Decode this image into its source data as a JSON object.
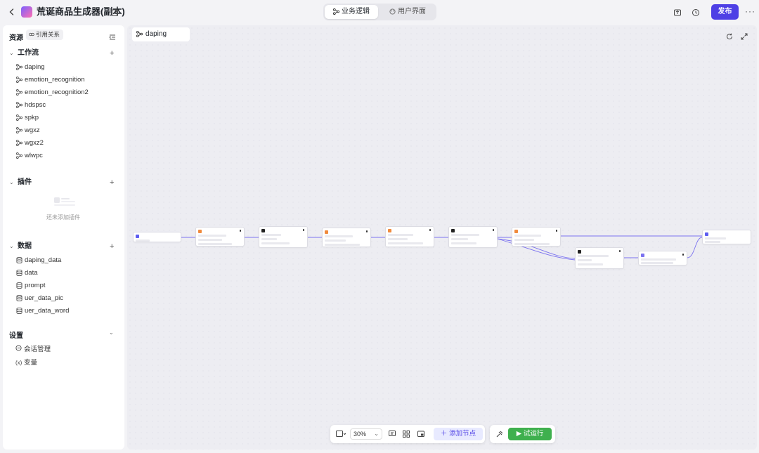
{
  "header": {
    "title": "荒诞商品生成器(副本)",
    "tabs": [
      {
        "label": "业务逻辑",
        "active": true
      },
      {
        "label": "用户界面",
        "active": false
      }
    ],
    "publish_label": "发布"
  },
  "sidebar": {
    "title": "资源",
    "ref_label": "引用关系",
    "workflow_title": "工作流",
    "workflows": [
      "daping",
      "emotion_recognition",
      "emotion_recognition2",
      "hdspsc",
      "spkp",
      "wgxz",
      "wgxz2",
      "wlwpc"
    ],
    "plugin_title": "插件",
    "plugin_empty": "还未添加插件",
    "data_title": "数据",
    "data_items": [
      "daping_data",
      "data",
      "prompt",
      "uer_data_pic",
      "uer_data_word"
    ],
    "settings_title": "设置",
    "settings_items": [
      {
        "icon": "chat-icon",
        "label": "会话管理"
      },
      {
        "icon": "variable-icon",
        "label": "变量"
      }
    ]
  },
  "canvas": {
    "tab_label": "daping",
    "zoom": "30%",
    "add_node_label": "添加节点",
    "run_label": "试运行"
  },
  "colors": {
    "primary": "#4e40e5",
    "run": "#3fb04e",
    "edge": "#7b72f0"
  }
}
